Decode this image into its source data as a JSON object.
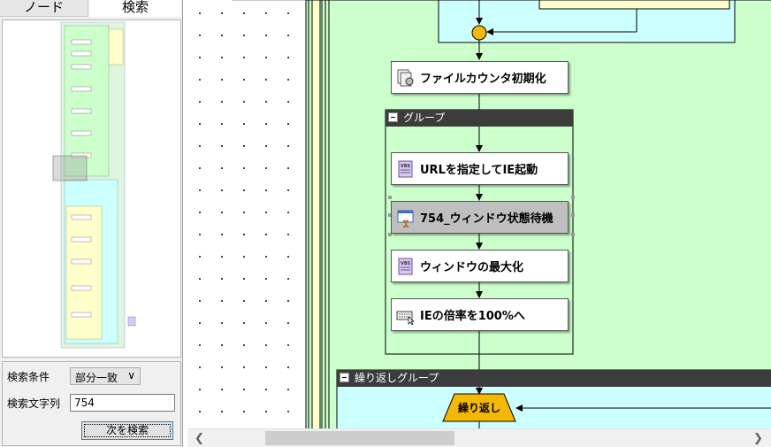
{
  "tabs": {
    "node": "ノード",
    "search": "検索"
  },
  "search": {
    "condition_label": "検索条件",
    "condition_value": "部分一致",
    "text_label": "検索文字列",
    "text_value": "754",
    "next_button": "次を検索"
  },
  "flow": {
    "node_file_counter": "ファイルカウンタ初期化",
    "group_label": "グループ",
    "node_open_ie": "URLを指定してIE起動",
    "node_wait_window": "754_ウィンドウ状態待機",
    "node_maximize": "ウィンドウの最大化",
    "node_zoom": "IEの倍率を100%へ",
    "loop_group_label": "繰り返しグループ",
    "loop_label": "繰り返し"
  },
  "colors": {
    "group_green": "#ccffcc",
    "loop_cyan": "#ccffff",
    "loop_yellow": "#ffffcc",
    "header_dark": "#3c3c3c",
    "junction": "#f5b800",
    "selected_node": "#bfbfbf"
  },
  "icons": {
    "file_counter": "gear-doc-icon",
    "open_ie": "vbs-script-icon",
    "wait_window": "window-hourglass-icon",
    "maximize": "vbs-script-icon",
    "zoom": "keyboard-cursor-icon"
  }
}
